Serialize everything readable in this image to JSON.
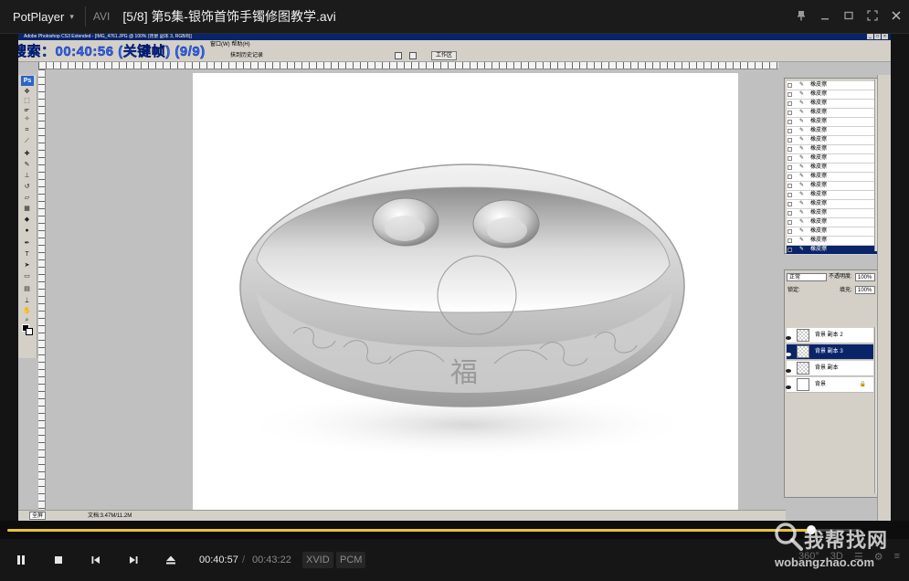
{
  "player": {
    "app_name": "PotPlayer",
    "format": "AVI",
    "title": "[5/8] 第5集-银饰首饰手镯修图教学.avi"
  },
  "photoshop": {
    "window_title": "Adobe Photoshop CS3 Extended - [IMG_4761.JPG @ 100% (背景 副本 3, RGB/8)]",
    "menu_last": "窗口(W)  帮助(H)",
    "option_history": "抹到历史记录",
    "workspace": "工作区",
    "toolbox_badge": "Ps",
    "status_zoom": "全屏",
    "status_doc": "文档:3.47M/11.2M",
    "history": {
      "items": [
        "橡皮擦",
        "橡皮擦",
        "橡皮擦",
        "橡皮擦",
        "橡皮擦",
        "橡皮擦",
        "橡皮擦",
        "橡皮擦",
        "橡皮擦",
        "橡皮擦",
        "橡皮擦",
        "橡皮擦",
        "橡皮擦",
        "橡皮擦",
        "橡皮擦",
        "橡皮擦",
        "橡皮擦",
        "橡皮擦",
        "橡皮擦"
      ],
      "selected_index": 18
    },
    "layers": {
      "blend_mode": "正常",
      "opacity_label": "不透明度:",
      "opacity": "100%",
      "lock_label": "锁定:",
      "fill_label": "填充:",
      "fill": "100%",
      "items": [
        {
          "name": "背景 副本 2",
          "selected": false
        },
        {
          "name": "背景 副本 3",
          "selected": true
        },
        {
          "name": "背景 副本",
          "selected": false
        },
        {
          "name": "背景",
          "selected": false
        }
      ]
    }
  },
  "overlay": {
    "search_text": "搜索：00:40:56 (关键帧) (9/9)"
  },
  "playback": {
    "current_time": "00:40:57",
    "separator": "/",
    "duration": "00:43:22",
    "progress": 0.942,
    "video_codec": "XVID",
    "audio_codec": "PCM",
    "right_labels": [
      "360°",
      "3D",
      "☰",
      "⚙",
      "≡"
    ]
  },
  "watermark": {
    "brand": "我帮找网",
    "domain": "wobangzhao.com"
  },
  "colors": {
    "accent": "#e8c33a",
    "ps_title": "#0a246a",
    "ps_chrome": "#d4d0c8",
    "search_overlay": "#2f66ff"
  },
  "icons": [
    "chevron-down-icon",
    "pin-icon",
    "minimize-icon",
    "maximize-icon",
    "fullscreen-icon",
    "close-icon",
    "pause-icon",
    "stop-icon",
    "previous-icon",
    "next-icon",
    "eject-icon",
    "eye-icon",
    "eraser-icon",
    "lock-icon",
    "magnifier-icon"
  ]
}
